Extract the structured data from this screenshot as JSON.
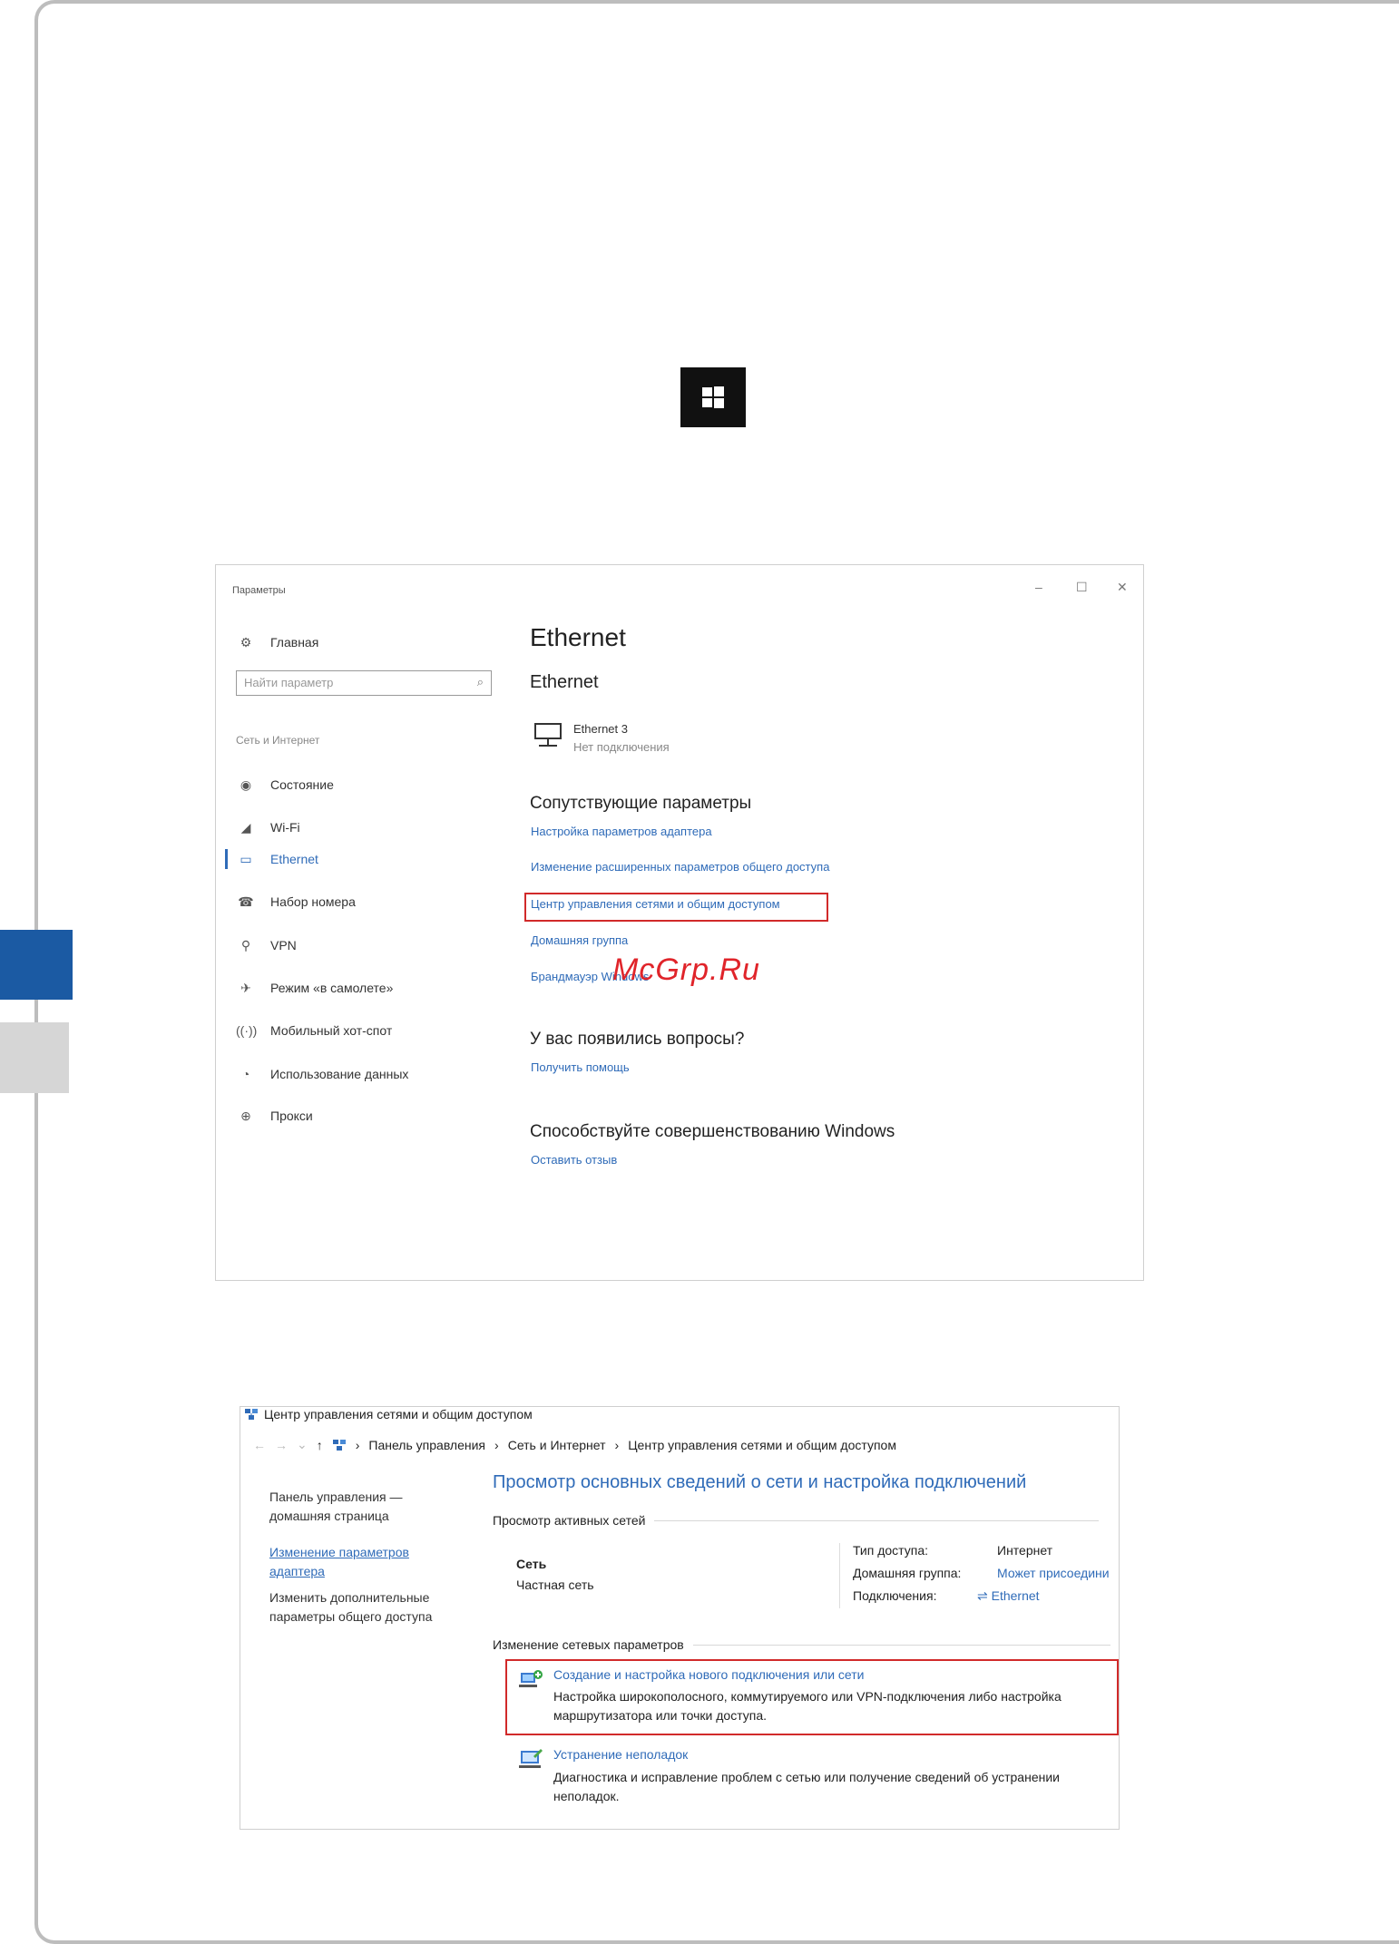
{
  "settings": {
    "window_title": "Параметры",
    "controls": {
      "minimize": "–",
      "maximize": "☐",
      "close": "✕"
    },
    "home_label": "Главная",
    "search_placeholder": "Найти параметр",
    "group_label": "Сеть и Интернет",
    "nav": [
      {
        "label": "Состояние",
        "icon": "status-icon"
      },
      {
        "label": "Wi-Fi",
        "icon": "wifi-icon"
      },
      {
        "label": "Ethernet",
        "icon": "ethernet-icon"
      },
      {
        "label": "Набор номера",
        "icon": "dialup-icon"
      },
      {
        "label": "VPN",
        "icon": "vpn-icon"
      },
      {
        "label": "Режим «в самолете»",
        "icon": "airplane-icon"
      },
      {
        "label": "Мобильный хот-спот",
        "icon": "hotspot-icon"
      },
      {
        "label": "Использование данных",
        "icon": "data-usage-icon"
      },
      {
        "label": "Прокси",
        "icon": "proxy-icon"
      }
    ],
    "page_title": "Ethernet",
    "section_title": "Ethernet",
    "adapter": {
      "name": "Ethernet 3",
      "status": "Нет подключения"
    },
    "related_title": "Сопутствующие параметры",
    "related_links": [
      "Настройка параметров адаптера",
      "Изменение расширенных параметров общего доступа",
      "Центр управления сетями и общим доступом",
      "Домашняя группа",
      "Брандмауэр Windows"
    ],
    "questions_title": "У вас появились вопросы?",
    "help_link": "Получить помощь",
    "improve_title": "Способствуйте совершенствованию Windows",
    "feedback_link": "Оставить отзыв"
  },
  "watermark": "McGrp.Ru",
  "control_panel": {
    "window_title": "Центр управления сетями и общим доступом",
    "breadcrumbs": [
      "Панель управления",
      "Сеть и Интернет",
      "Центр управления сетями и общим доступом"
    ],
    "left_home_1": "Панель управления —",
    "left_home_2": "домашняя страница",
    "left_link_1": "Изменение параметров",
    "left_link_2": "адаптера",
    "left_text_1": "Изменить дополнительные",
    "left_text_2": "параметры общего доступа",
    "main_title": "Просмотр основных сведений о сети и настройка подключений",
    "active_networks": "Просмотр активных сетей",
    "network_name": "Сеть",
    "network_type": "Частная сеть",
    "access_type_label": "Тип доступа:",
    "access_type_value": "Интернет",
    "homegroup_label": "Домашняя группа:",
    "homegroup_value": "Может присоедини",
    "connections_label": "Подключения:",
    "connections_value": "Ethernet",
    "change_settings": "Изменение сетевых параметров",
    "item1_title": "Создание и настройка нового подключения или сети",
    "item1_desc": "Настройка широкополосного, коммутируемого или VPN-подключения либо настройка маршрутизатора или точки доступа.",
    "item2_title": "Устранение неполадок",
    "item2_desc": "Диагностика и исправление проблем с сетью или получение сведений об устранении неполадок."
  },
  "colors": {
    "accent": "#2f6bb8",
    "highlight": "#d12a2a",
    "side_tab": "#1b5aa3",
    "watermark": "#e0242a"
  }
}
